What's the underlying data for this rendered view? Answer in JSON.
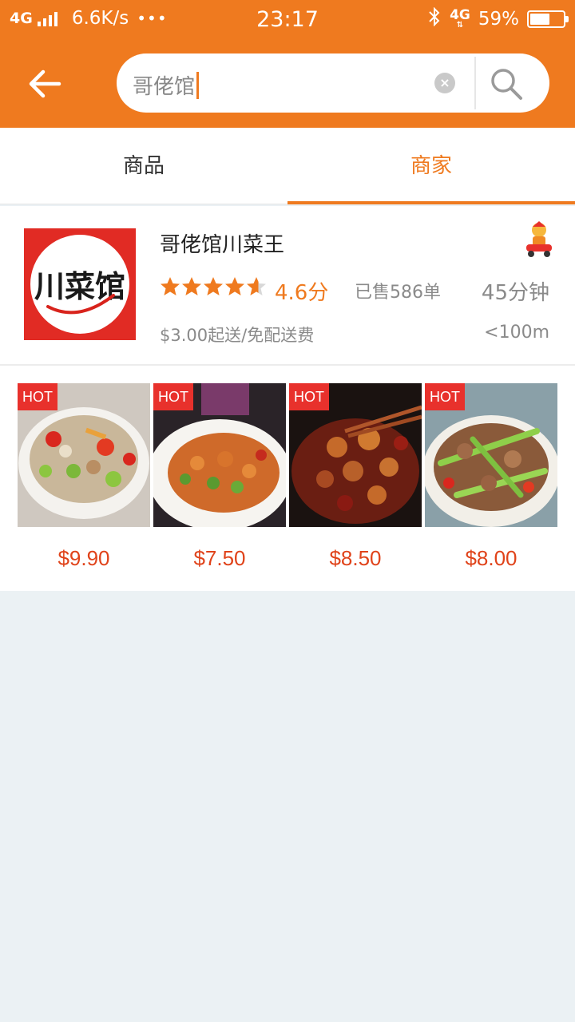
{
  "status_bar": {
    "network": "4G",
    "speed": "6.6K/s",
    "dots": "•••",
    "time": "23:17",
    "network2": "4G",
    "battery_pct": "59%",
    "battery_level": 0.59
  },
  "search": {
    "value": "哥佬馆",
    "clear_label": "×"
  },
  "tabs": [
    {
      "label": "商品",
      "active": false
    },
    {
      "label": "商家",
      "active": true
    }
  ],
  "store": {
    "name": "哥佬馆川菜王",
    "logo_text": "川菜馆",
    "rating_value": 4.6,
    "rating": "4.6分",
    "sold": "已售586单",
    "delivery_time": "45分钟",
    "delivery_info": "$3.00起送/免配送费",
    "distance": "<100m"
  },
  "dishes": [
    {
      "badge": "HOT",
      "price": "$9.90",
      "image": "stir-fried-pork-peppers"
    },
    {
      "badge": "HOT",
      "price": "$7.50",
      "image": "kung-pao-beans"
    },
    {
      "badge": "HOT",
      "price": "$8.50",
      "image": "spicy-chicken-chilies"
    },
    {
      "badge": "HOT",
      "price": "$8.00",
      "image": "beef-scallion-stirfry"
    }
  ],
  "colors": {
    "accent": "#ef7a1f",
    "price": "#e0431a",
    "hot": "#e8312c",
    "background": "#ebf1f4"
  }
}
